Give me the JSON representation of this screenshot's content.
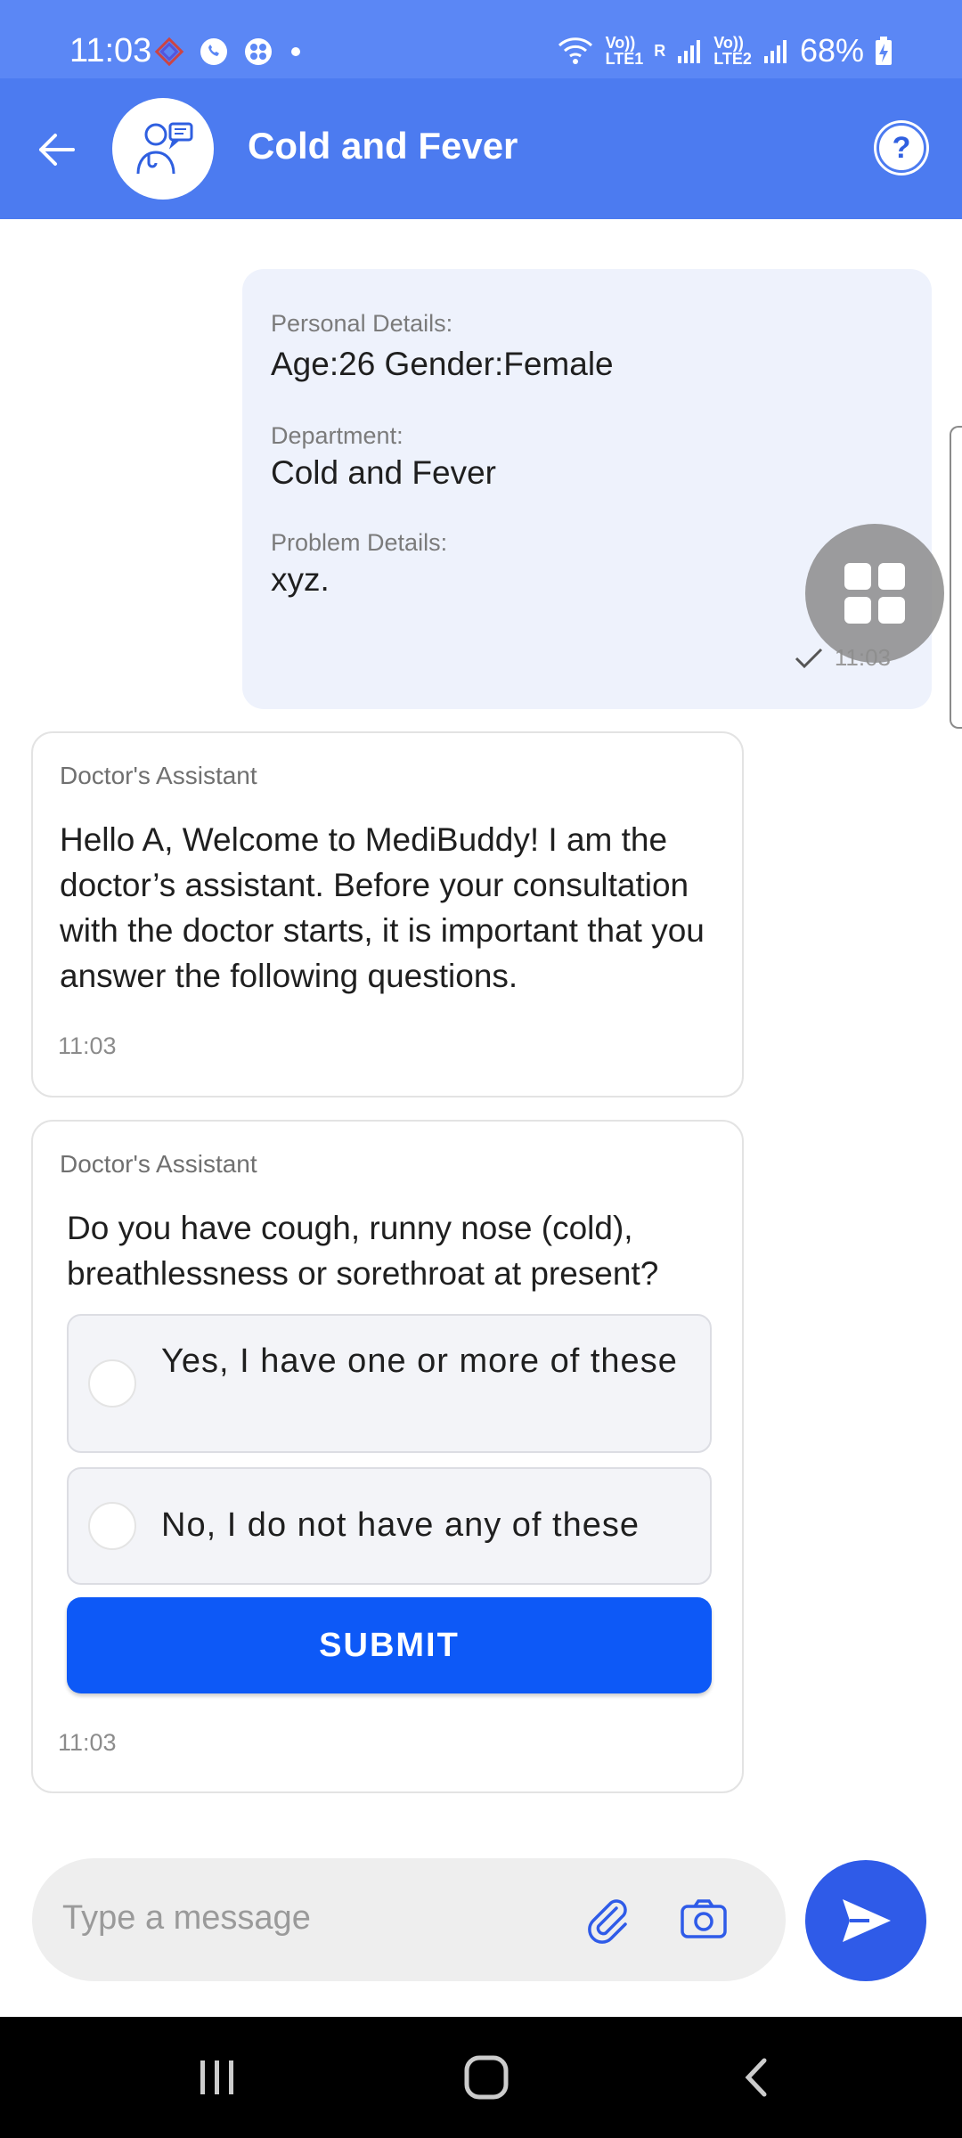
{
  "status_bar": {
    "time": "11:03",
    "battery": "68%",
    "sim1_top": "Vo))",
    "sim1_bottom": "LTE1",
    "roaming": "R",
    "sim2_top": "Vo))",
    "sim2_bottom": "LTE2"
  },
  "header": {
    "title": "Cold and Fever",
    "help_label": "?"
  },
  "personal_details": {
    "label_personal": "Personal Details:",
    "value_personal": "Age:26 Gender:Female",
    "label_department": "Department:",
    "value_department": "Cold and Fever",
    "label_problem": "Problem Details:",
    "value_problem": "xyz.",
    "time": "11:03"
  },
  "welcome_card": {
    "sender": "Doctor's Assistant",
    "message": "Hello A, Welcome to MediBuddy! I am the doctor’s assistant. Before your consultation with the doctor starts, it is important that you answer the following questions.",
    "time": "11:03"
  },
  "question_card": {
    "sender": "Doctor's Assistant",
    "question": "Do you have cough, runny nose (cold), breathlessness or sorethroat at present?",
    "options": [
      {
        "label": "Yes, I have one or more of these"
      },
      {
        "label": "No, I do not have any of these"
      }
    ],
    "submit_label": "SUBMIT",
    "time": "11:03"
  },
  "composer": {
    "placeholder": "Type a message"
  },
  "colors": {
    "status_bar": "#5b87f5",
    "header": "#4c7bf0",
    "submit": "#0d59f7",
    "send": "#2f5be8",
    "user_bubble": "#eef2fc"
  }
}
